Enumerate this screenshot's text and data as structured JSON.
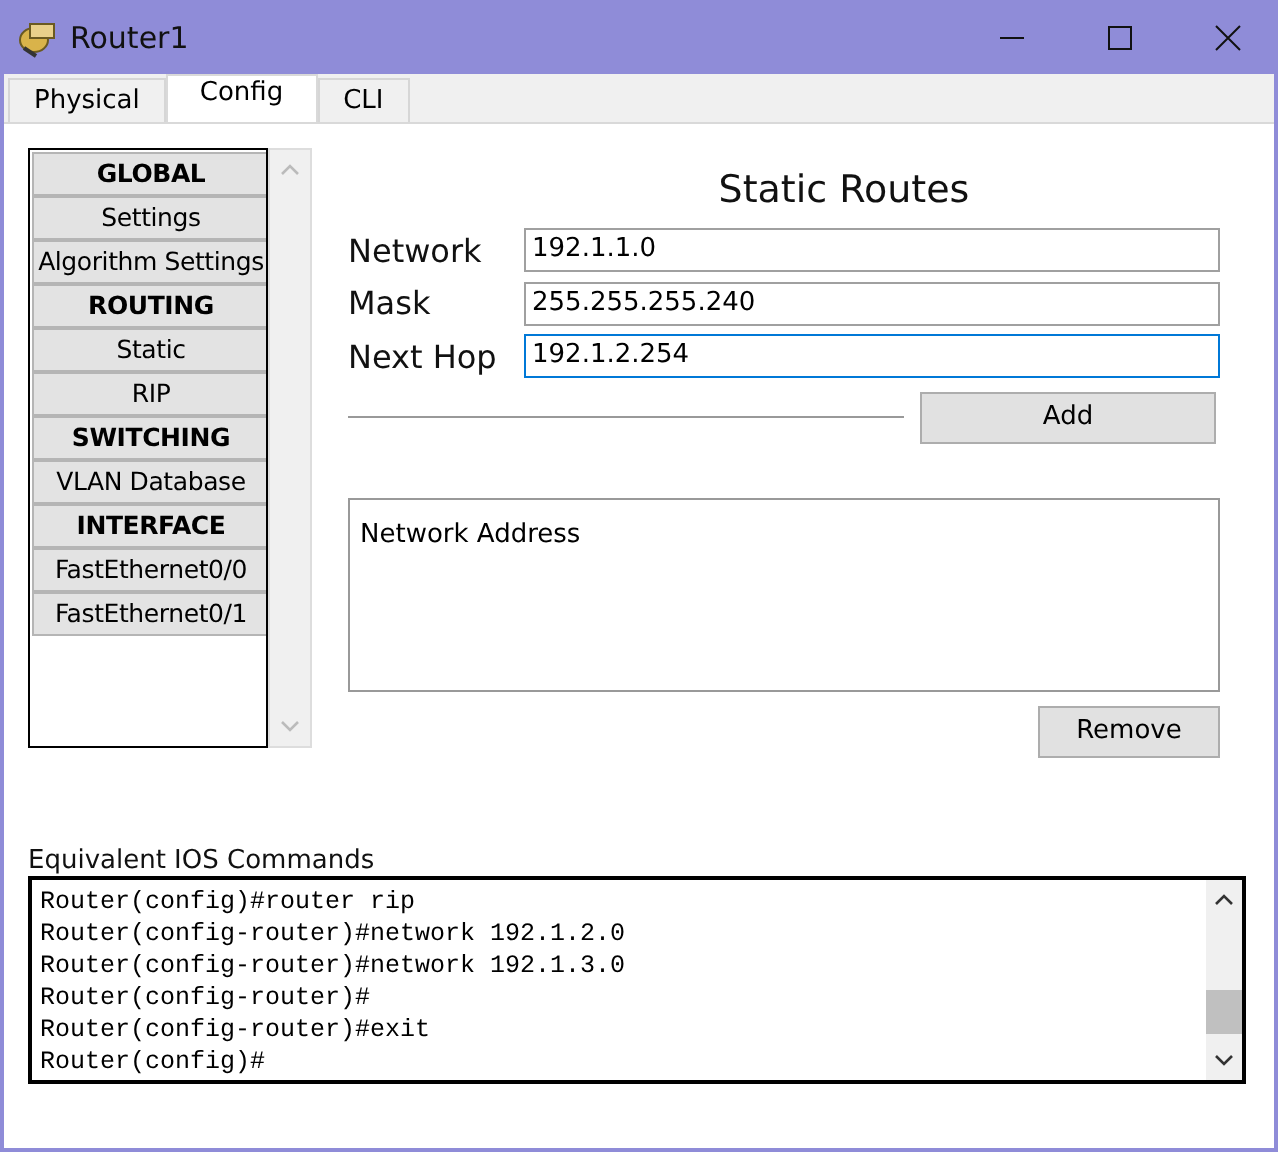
{
  "window": {
    "title": "Router1"
  },
  "tabs": [
    {
      "label": "Physical",
      "selected": false
    },
    {
      "label": "Config",
      "selected": true
    },
    {
      "label": "CLI",
      "selected": false
    }
  ],
  "sidebar": {
    "items": [
      {
        "label": "GLOBAL",
        "kind": "header"
      },
      {
        "label": "Settings",
        "kind": "item"
      },
      {
        "label": "Algorithm Settings",
        "kind": "item"
      },
      {
        "label": "ROUTING",
        "kind": "header"
      },
      {
        "label": "Static",
        "kind": "item"
      },
      {
        "label": "RIP",
        "kind": "item"
      },
      {
        "label": "SWITCHING",
        "kind": "header"
      },
      {
        "label": "VLAN Database",
        "kind": "item"
      },
      {
        "label": "INTERFACE",
        "kind": "header"
      },
      {
        "label": "FastEthernet0/0",
        "kind": "item"
      },
      {
        "label": "FastEthernet0/1",
        "kind": "item"
      }
    ]
  },
  "static_routes": {
    "title": "Static Routes",
    "fields": [
      {
        "label": "Network",
        "value": "192.1.1.0",
        "focused": false
      },
      {
        "label": "Mask",
        "value": "255.255.255.240",
        "focused": false
      },
      {
        "label": "Next Hop",
        "value": "192.1.2.254",
        "focused": true
      }
    ],
    "add_button": "Add",
    "list_header": "Network Address",
    "remove_button": "Remove"
  },
  "console": {
    "label": "Equivalent IOS Commands",
    "lines": [
      "Router(config)#router rip",
      "Router(config-router)#network 192.1.2.0",
      "Router(config-router)#network 192.1.3.0",
      "Router(config-router)#",
      "Router(config-router)#exit",
      "Router(config)#"
    ]
  }
}
